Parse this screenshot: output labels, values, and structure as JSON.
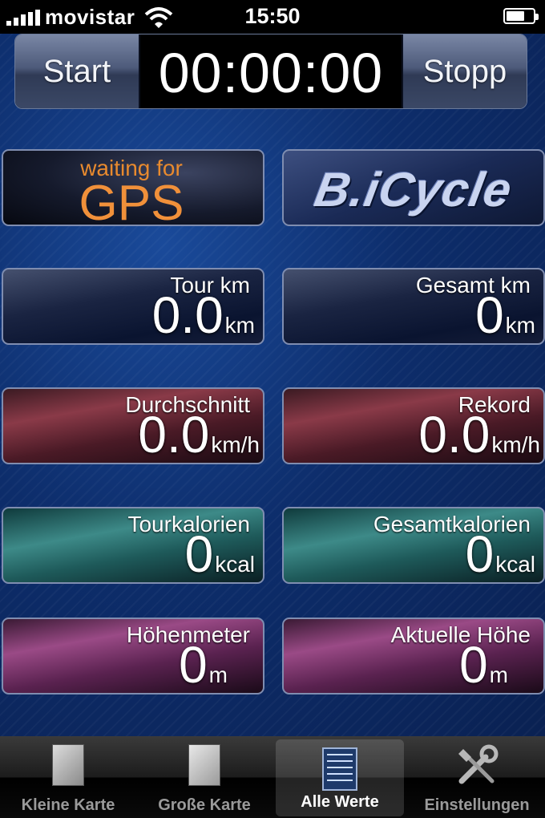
{
  "status_bar": {
    "carrier": "movistar",
    "time": "15:50",
    "battery_level": 0.7
  },
  "timer": {
    "start_label": "Start",
    "time": "00:00:00",
    "stop_label": "Stopp"
  },
  "gps": {
    "waiting_text": "waiting for",
    "gps_text": "GPS"
  },
  "logo": {
    "text": "B.iCycle"
  },
  "tiles": [
    {
      "label": "Tour km",
      "value": "0.0",
      "unit": "km"
    },
    {
      "label": "Gesamt km",
      "value": "0",
      "unit": "km"
    },
    {
      "label": "Durchschnitt",
      "value": "0.0",
      "unit": "km/h"
    },
    {
      "label": "Rekord",
      "value": "0.0",
      "unit": "km/h"
    },
    {
      "label": "Tourkalorien",
      "value": "0",
      "unit": "kcal"
    },
    {
      "label": "Gesamtkalorien",
      "value": "0",
      "unit": "kcal"
    },
    {
      "label": "Höhenmeter",
      "value": "0",
      "unit": "m"
    },
    {
      "label": "Aktuelle Höhe",
      "value": "0",
      "unit": "m"
    }
  ],
  "tab_bar": {
    "tabs": [
      {
        "label": "Kleine Karte",
        "icon": "small-map-icon"
      },
      {
        "label": "Große Karte",
        "icon": "large-map-icon"
      },
      {
        "label": "Alle Werte",
        "icon": "all-values-icon",
        "active": true
      },
      {
        "label": "Einstellungen",
        "icon": "settings-icon"
      }
    ]
  },
  "colors": {
    "accent_orange": "#f0903a",
    "background_blue": "#0d2d6b"
  }
}
